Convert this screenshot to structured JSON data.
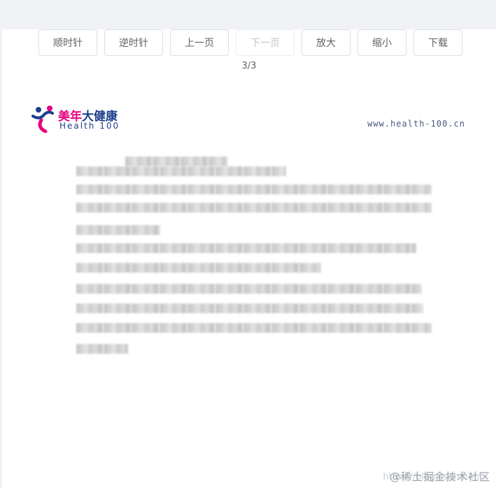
{
  "toolbar": {
    "buttons": [
      {
        "label": "顺时针",
        "disabled": false
      },
      {
        "label": "逆时针",
        "disabled": false
      },
      {
        "label": "上一页",
        "disabled": false
      },
      {
        "label": "下一页",
        "disabled": true
      },
      {
        "label": "放大",
        "disabled": false
      },
      {
        "label": "缩小",
        "disabled": false
      },
      {
        "label": "下载",
        "disabled": false
      }
    ]
  },
  "pager": {
    "indicator": "3/3",
    "current_page": 3,
    "total_pages": 3
  },
  "document": {
    "logo_cn_part1": "美年",
    "logo_cn_part2": "大健康",
    "logo_en": "Health 100",
    "site_url": "www.health-100.cn",
    "body_text_redacted": true
  },
  "watermark": {
    "main": "@稀土掘金技术社区",
    "url": "https://blog.csdn.net/..."
  },
  "colors": {
    "accent_pink": "#e6007e",
    "brand_blue": "#1d3f8c",
    "button_border": "#dcdfe6",
    "button_text": "#606266",
    "disabled_text": "#c0c4cc"
  }
}
